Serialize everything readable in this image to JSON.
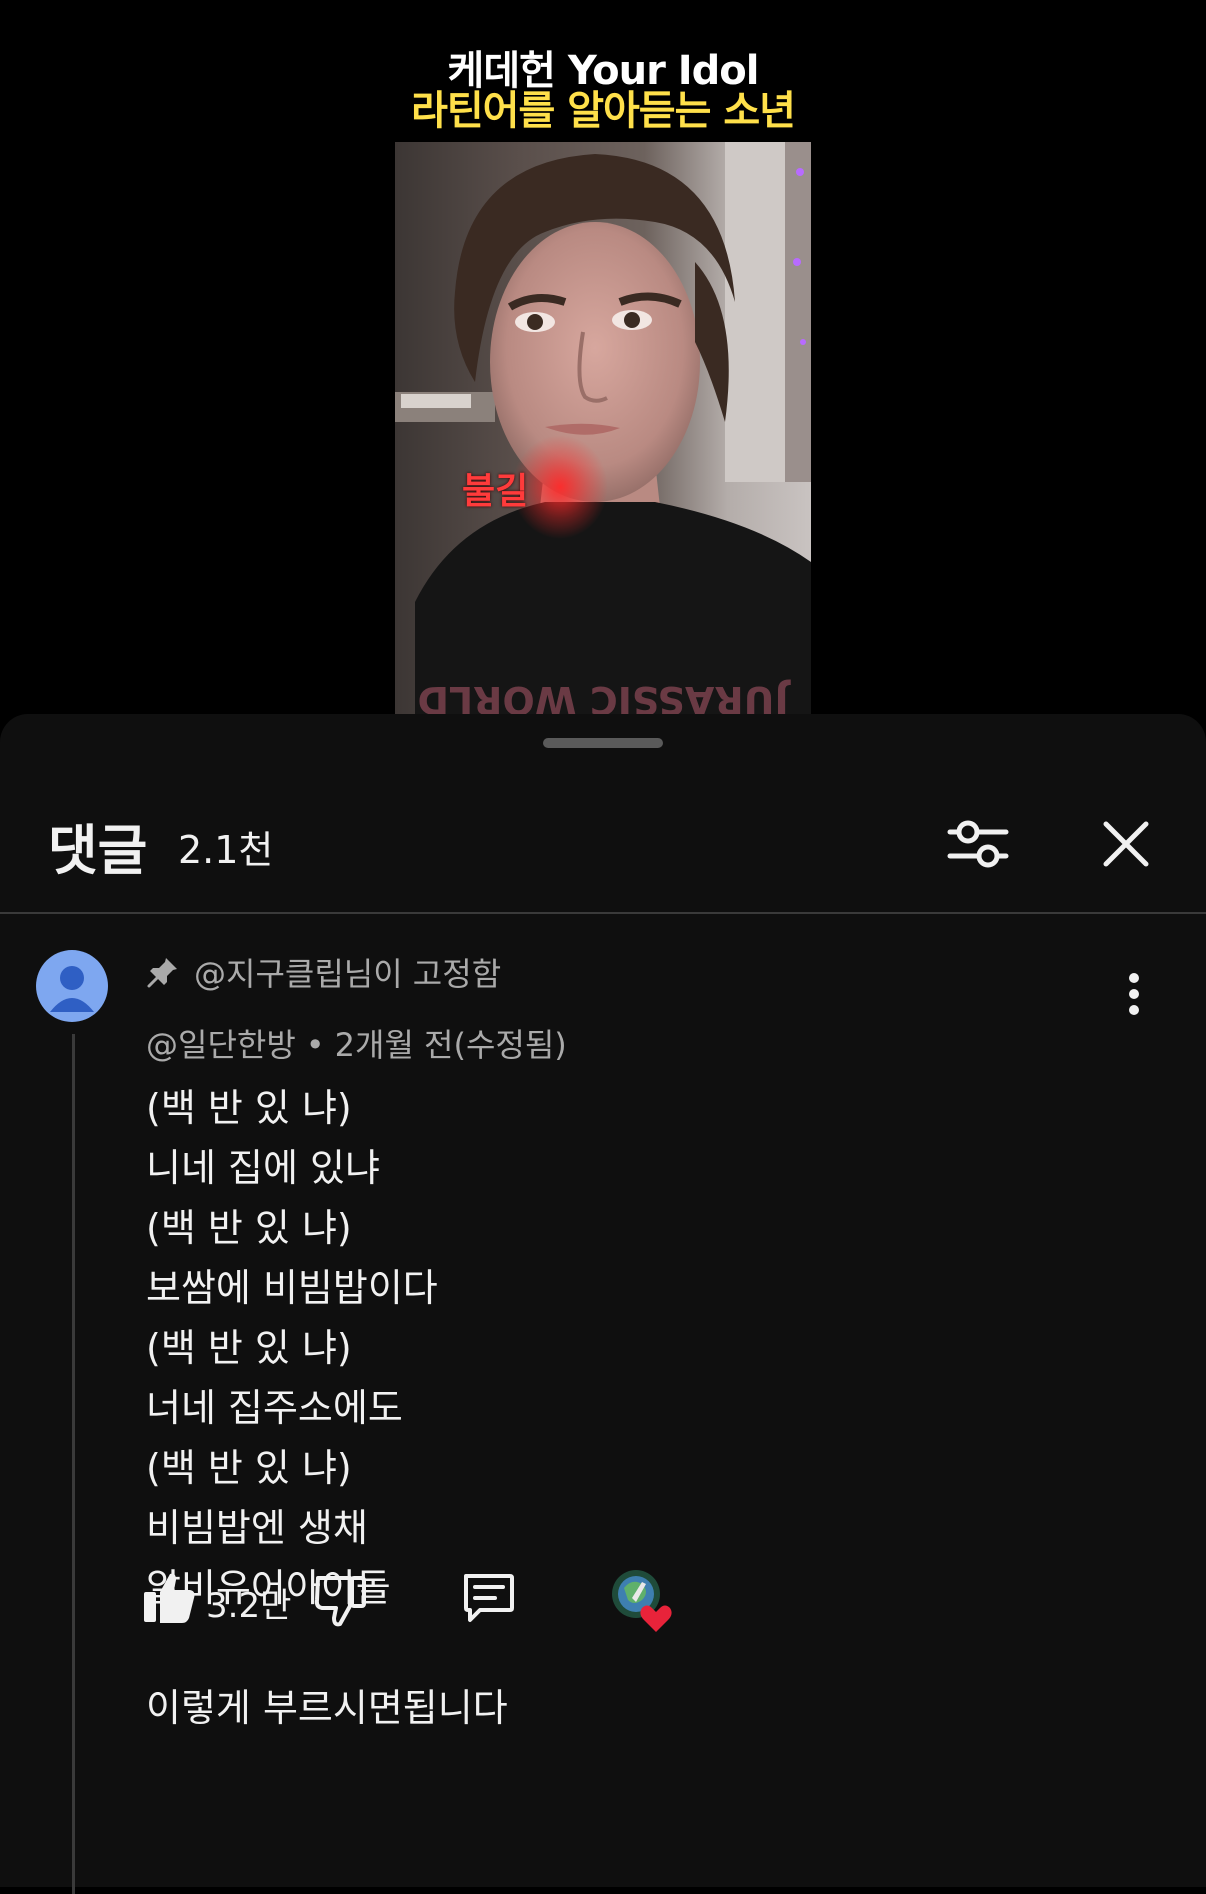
{
  "video": {
    "title_line1": "케데헌 Your Idol",
    "title_line2": "라틴어를 알아듣는 소년",
    "caption": "불길",
    "shirt_text": "JURASSIC WORLD",
    "colors": {
      "title_line2": "#ffe04a",
      "caption": "#ff3b3b"
    }
  },
  "comments_panel": {
    "title": "댓글",
    "count": "2.1천",
    "filter_icon": "sliders-icon",
    "close_icon": "close-icon"
  },
  "comment": {
    "pinned_label": "@지구클립님이 고정함",
    "author": "@일단한방",
    "separator": "•",
    "time": "2개월 전(수정됨)",
    "lines": [
      "(백 반 있 냐)",
      "니네 집에 있냐",
      "(백 반 있 냐)",
      "보쌈에 비빔밥이다",
      "(백 반 있 냐)",
      "너네 집주소에도",
      "(백 반 있 냐)",
      "비빔밥엔 생채",
      "알비유어아이돌",
      "",
      "이렇게 부르시면됩니다"
    ],
    "like_count": "3.2만",
    "icons": [
      "pin-icon",
      "more-vert-icon",
      "thumbs-up-icon",
      "thumbs-down-icon",
      "reply-icon",
      "creator-heart-icon"
    ]
  }
}
